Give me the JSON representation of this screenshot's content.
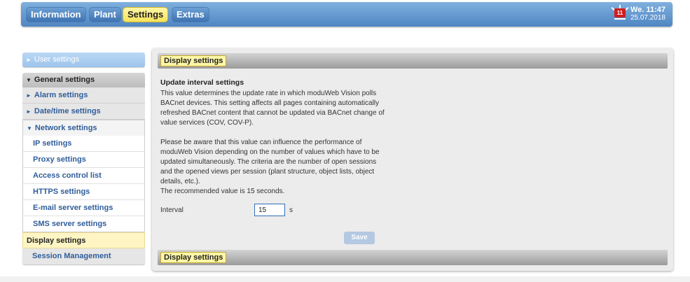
{
  "header": {
    "tabs": [
      {
        "label": "Information",
        "active": false
      },
      {
        "label": "Plant",
        "active": false
      },
      {
        "label": "Settings",
        "active": true
      },
      {
        "label": "Extras",
        "active": false
      }
    ],
    "alarm_badge": "11",
    "clock_day": "We. 11:47",
    "clock_date": "25.07.2018"
  },
  "sidebar": {
    "user_settings": "User settings",
    "general_settings": "General settings",
    "alarm_settings": "Alarm settings",
    "datetime_settings": "Date/time settings",
    "network_settings": "Network settings",
    "network_items": [
      "IP settings",
      "Proxy settings",
      "Access control list",
      "HTTPS settings",
      "E-mail server settings",
      "SMS server settings"
    ],
    "display_settings": "Display settings",
    "session_management": "Session Management"
  },
  "panel": {
    "header_title": "Display settings",
    "footer_title": "Display settings",
    "section_title": "Update interval settings",
    "paragraph1": "This value determines the update rate in which moduWeb Vision polls BACnet devices. This setting affects all pages containing automatically refreshed BACnet content that cannot be updated via BACnet change of value services (COV, COV-P).",
    "paragraph2": "Please be aware that this value can influence the performance of moduWeb Vision depending on the number of values which have to be updated simultaneously. The criteria are the number of open sessions and the opened views per session (plant structure, object lists, object details, etc.).",
    "recommended": "The recommended value is 15 seconds.",
    "interval_label": "Interval",
    "interval_value": "15",
    "interval_unit": "s",
    "save_label": "Save"
  },
  "colors": {
    "header_blue": "#4f86c3",
    "active_tab_yellow": "#f7e35a",
    "link_blue": "#2f5d9a",
    "save_disabled": "#b4c8e2"
  }
}
